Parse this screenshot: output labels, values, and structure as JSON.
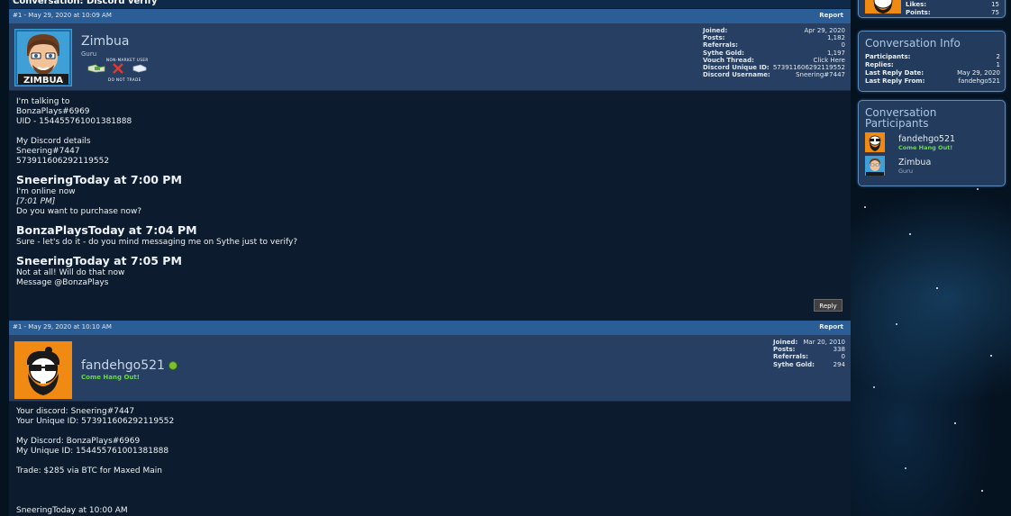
{
  "conversation": {
    "title": "Conversation: Discord verify"
  },
  "posts": [
    {
      "number": "#1 - May 29, 2020 at 10:09 AM",
      "report": "Report",
      "username": "Zimbua",
      "user_title": "Guru",
      "badges": {
        "line1": "NON-MARKET USER",
        "line2": "DO NOT TRADE"
      },
      "stats": [
        {
          "label": "Joined:",
          "value": "Apr 29, 2020"
        },
        {
          "label": "Posts:",
          "value": "1,182"
        },
        {
          "label": "Referrals:",
          "value": "0"
        },
        {
          "label": "Sythe Gold:",
          "value": "1,197"
        },
        {
          "label": "Vouch Thread:",
          "value": "Click Here"
        },
        {
          "label": "Discord Unique ID:",
          "value": "573911606292119552"
        },
        {
          "label": "Discord Username:",
          "value": "Sneering#7447"
        }
      ],
      "lines": {
        "l1": "I'm talking to",
        "l2": "BonzaPlays#6969",
        "l3": "UID - 154455761001381888",
        "l4": "My Discord details",
        "l5": "Sneering#7447",
        "l6": "573911606292119552",
        "h1": "SneeringToday at 7:00 PM",
        "l7": "I'm online now",
        "l8": "[7:01 PM]",
        "l9": "Do you want to purchase now?",
        "h2": "BonzaPlaysToday at 7:04 PM",
        "l10": "Sure - let's do it - do you mind messaging me on Sythe just to verify?",
        "h3": "SneeringToday at 7:05 PM",
        "l11": "Not at all! Will do that now",
        "l12": "Message @BonzaPlays"
      },
      "reply": "Reply"
    },
    {
      "number": "#1 - May 29, 2020 at 10:10 AM",
      "report": "Report",
      "username": "fandehgo521",
      "user_title": "Come Hang Out!",
      "stats": [
        {
          "label": "Joined:",
          "value": "Mar 20, 2010"
        },
        {
          "label": "Posts:",
          "value": "338"
        },
        {
          "label": "Referrals:",
          "value": "0"
        },
        {
          "label": "Sythe Gold:",
          "value": "294"
        }
      ],
      "lines": {
        "l1": "Your discord: Sneering#7447",
        "l2": "Your Unique ID: 573911606292119552",
        "l3": "My Discord: BonzaPlays#6969",
        "l4": "My Unique ID: 154455761001381888",
        "l5": "Trade: $285 via BTC for Maxed Main",
        "l6": "SneeringToday at 10:00 AM"
      }
    }
  ],
  "sidebar": {
    "profile": {
      "likes_label": "Likes:",
      "likes": "15",
      "points_label": "Points:",
      "points": "75"
    },
    "info": {
      "title": "Conversation Info",
      "rows": [
        {
          "label": "Participants:",
          "value": "2"
        },
        {
          "label": "Replies:",
          "value": "1"
        },
        {
          "label": "Last Reply Date:",
          "value": "May 29, 2020"
        },
        {
          "label": "Last Reply From:",
          "value": "fandehgo521"
        }
      ]
    },
    "participants": {
      "title_line1": "Conversation",
      "title_line2": "Participants",
      "items": [
        {
          "name": "fandehgo521",
          "sub": "Come Hang Out!",
          "sub_color": "#6ad84a"
        },
        {
          "name": "Zimbua",
          "sub": "Guru",
          "sub_color": "#9fb0c2"
        }
      ]
    }
  },
  "colors": {
    "accent": "#2b5d96",
    "panel_border": "#5d8cbd",
    "online": "#7cc02c",
    "green_title": "#6ad84a"
  }
}
